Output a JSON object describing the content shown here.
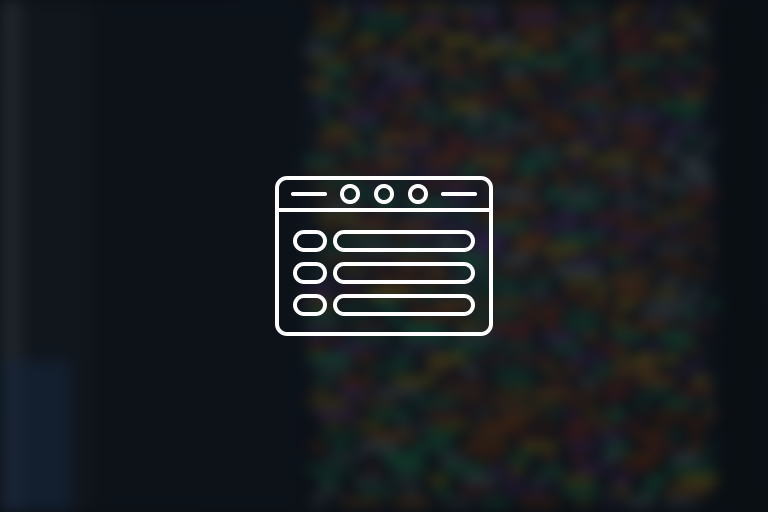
{
  "background": {
    "description_icon": "code-editor-photo",
    "base_color": "#0f141b",
    "code_colors": [
      "#c0392b",
      "#d35400",
      "#27ae60",
      "#f1c40f",
      "#2ecc71",
      "#e67e22",
      "#8e44ad",
      "#95a5a6"
    ]
  },
  "overlay": {
    "icon": "browser-window-list-icon",
    "stroke_color": "#ffffff"
  }
}
